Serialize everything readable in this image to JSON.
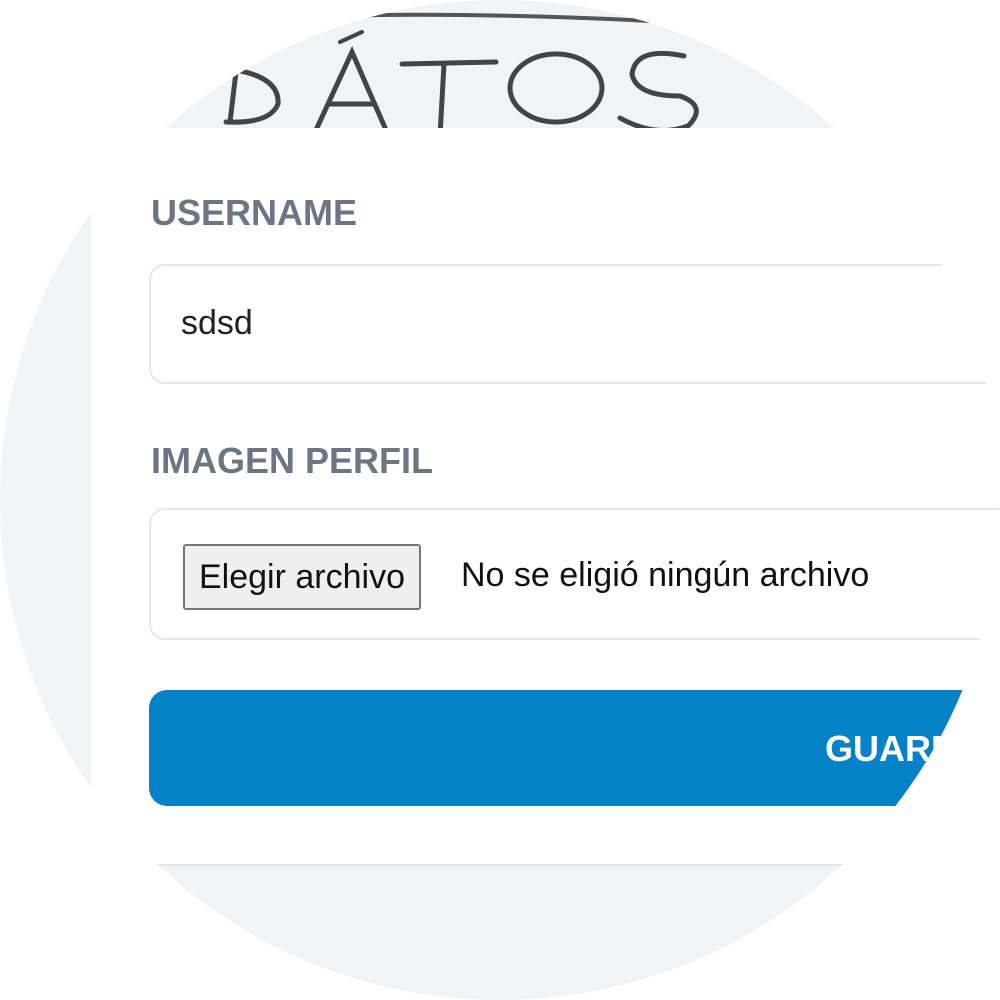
{
  "header": {
    "title": "DATOS"
  },
  "form": {
    "username_label": "USERNAME",
    "username_value": "sdsd",
    "image_label": "IMAGEN PERFIL",
    "file_button_label": "Elegir archivo",
    "file_status": "No se eligió ningún archivo",
    "save_label": "GUARDAR"
  },
  "colors": {
    "background": "#f2f3f5",
    "label": "#6b7584",
    "primary_button": "#0582c8"
  }
}
